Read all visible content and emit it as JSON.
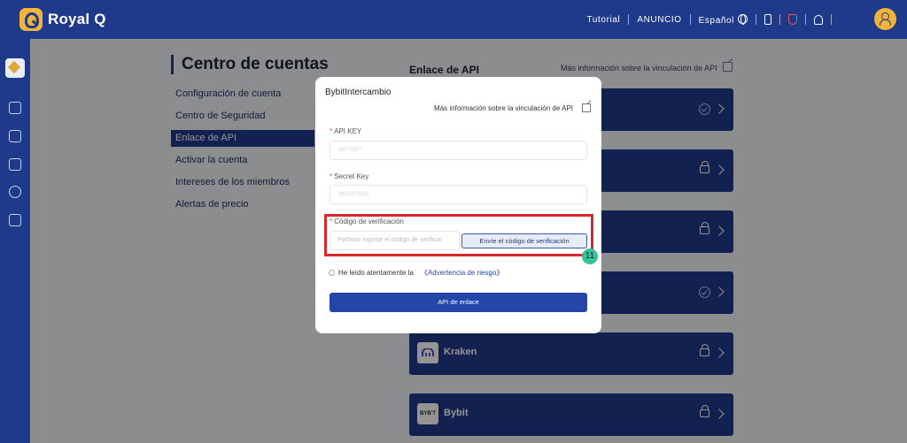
{
  "header": {
    "brand": "Royal Q",
    "nav": [
      "Tutorial",
      "ANUNCIO",
      "Español"
    ]
  },
  "account": {
    "title": "Centro de cuentas",
    "menu": [
      "Configuración de cuenta",
      "Centro de Seguridad",
      "Enlace de API",
      "Activar la cuenta",
      "Intereses de los miembros",
      "Alertas de precio"
    ],
    "active_index": 2
  },
  "api": {
    "heading": "Enlace de API",
    "more_link": "Más información sobre la vinculación de API",
    "exchanges": [
      {
        "name": "",
        "logo": "",
        "status": "linked"
      },
      {
        "name": "",
        "logo": "",
        "status": "locked"
      },
      {
        "name": "",
        "logo": "",
        "status": "locked"
      },
      {
        "name": "",
        "logo": "",
        "status": "linked"
      },
      {
        "name": "Kraken",
        "logo": "kraken-icon",
        "status": "locked"
      },
      {
        "name": "Bybit",
        "logo": "BYB'T",
        "status": "locked"
      }
    ]
  },
  "modal": {
    "title": "BybitIntercambio",
    "more_link": "Más información sobre la vinculación de API",
    "api_key_label": "API KEY",
    "api_key_placeholder": "API KEY",
    "secret_label": "Secret Key",
    "secret_placeholder": "Secret Key",
    "code_label": "Código de verificación",
    "code_placeholder": "Porfavor ingrese el codigo de verificac",
    "send_code": "Envíe el código de verificación",
    "agree_text": "He leído atentamente la",
    "risk_link": "《Advertencia de riesgo》",
    "submit": "API de enlace"
  },
  "annotation": {
    "step": "11",
    "color": "#d9262c"
  },
  "colors": {
    "primary": "#1f3a8a",
    "accent": "#f0b43c",
    "badge": "#35c39a"
  }
}
